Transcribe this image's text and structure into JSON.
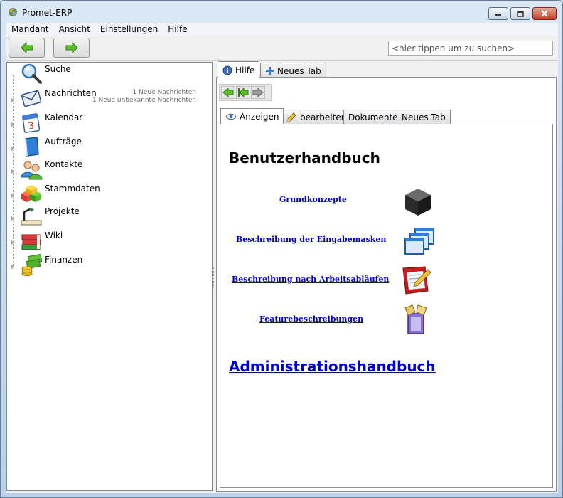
{
  "window": {
    "title": "Promet-ERP",
    "accent_color": "#c43b25"
  },
  "menu": [
    "Mandant",
    "Ansicht",
    "Einstellungen",
    "Hilfe"
  ],
  "toolbar": {
    "back_icon": "arrow-left-icon",
    "forward_icon": "arrow-right-icon",
    "search_placeholder": "<hier tippen um zu suchen>"
  },
  "tree": {
    "items": [
      {
        "label": "Suche",
        "icon": "search-icon"
      },
      {
        "label": "Nachrichten",
        "icon": "mail-icon",
        "info": [
          "1 Neue Nachrichten",
          "1 Neue unbekannte Nachrichten"
        ]
      },
      {
        "label": "Kalendar",
        "icon": "calendar-icon",
        "icon_text": "3"
      },
      {
        "label": "Aufträge",
        "icon": "book-icon"
      },
      {
        "label": "Kontakte",
        "icon": "contacts-icon"
      },
      {
        "label": "Stammdaten",
        "icon": "cubes-icon"
      },
      {
        "label": "Projekte",
        "icon": "projects-icon"
      },
      {
        "label": "Wiki",
        "icon": "books-icon"
      },
      {
        "label": "Finanzen",
        "icon": "money-icon"
      }
    ]
  },
  "tabs": {
    "main": [
      {
        "label": "Hilfe",
        "icon": "info-icon",
        "active": true
      },
      {
        "label": "Neues Tab",
        "icon": "plus-icon",
        "active": false
      }
    ],
    "inner": [
      {
        "label": "Anzeigen",
        "icon": "eye-icon",
        "active": true
      },
      {
        "label": "bearbeiten",
        "icon": "pencil-icon",
        "active": false
      },
      {
        "label": "Dokumente",
        "active": false
      },
      {
        "label": "Neues Tab",
        "active": false
      }
    ]
  },
  "doc": {
    "title": "Benutzerhandbuch",
    "links": [
      {
        "label": "Grundkonzepte",
        "icon": "cube-icon"
      },
      {
        "label": "Beschreibung der Eingabemasken",
        "icon": "windows-icon"
      },
      {
        "label": "Beschreibung nach Arbeitsabläufen",
        "icon": "edit-document-icon"
      },
      {
        "label": "Featurebeschreibungen",
        "icon": "box-icon"
      }
    ],
    "admin_link": "Administrationshandbuch"
  }
}
